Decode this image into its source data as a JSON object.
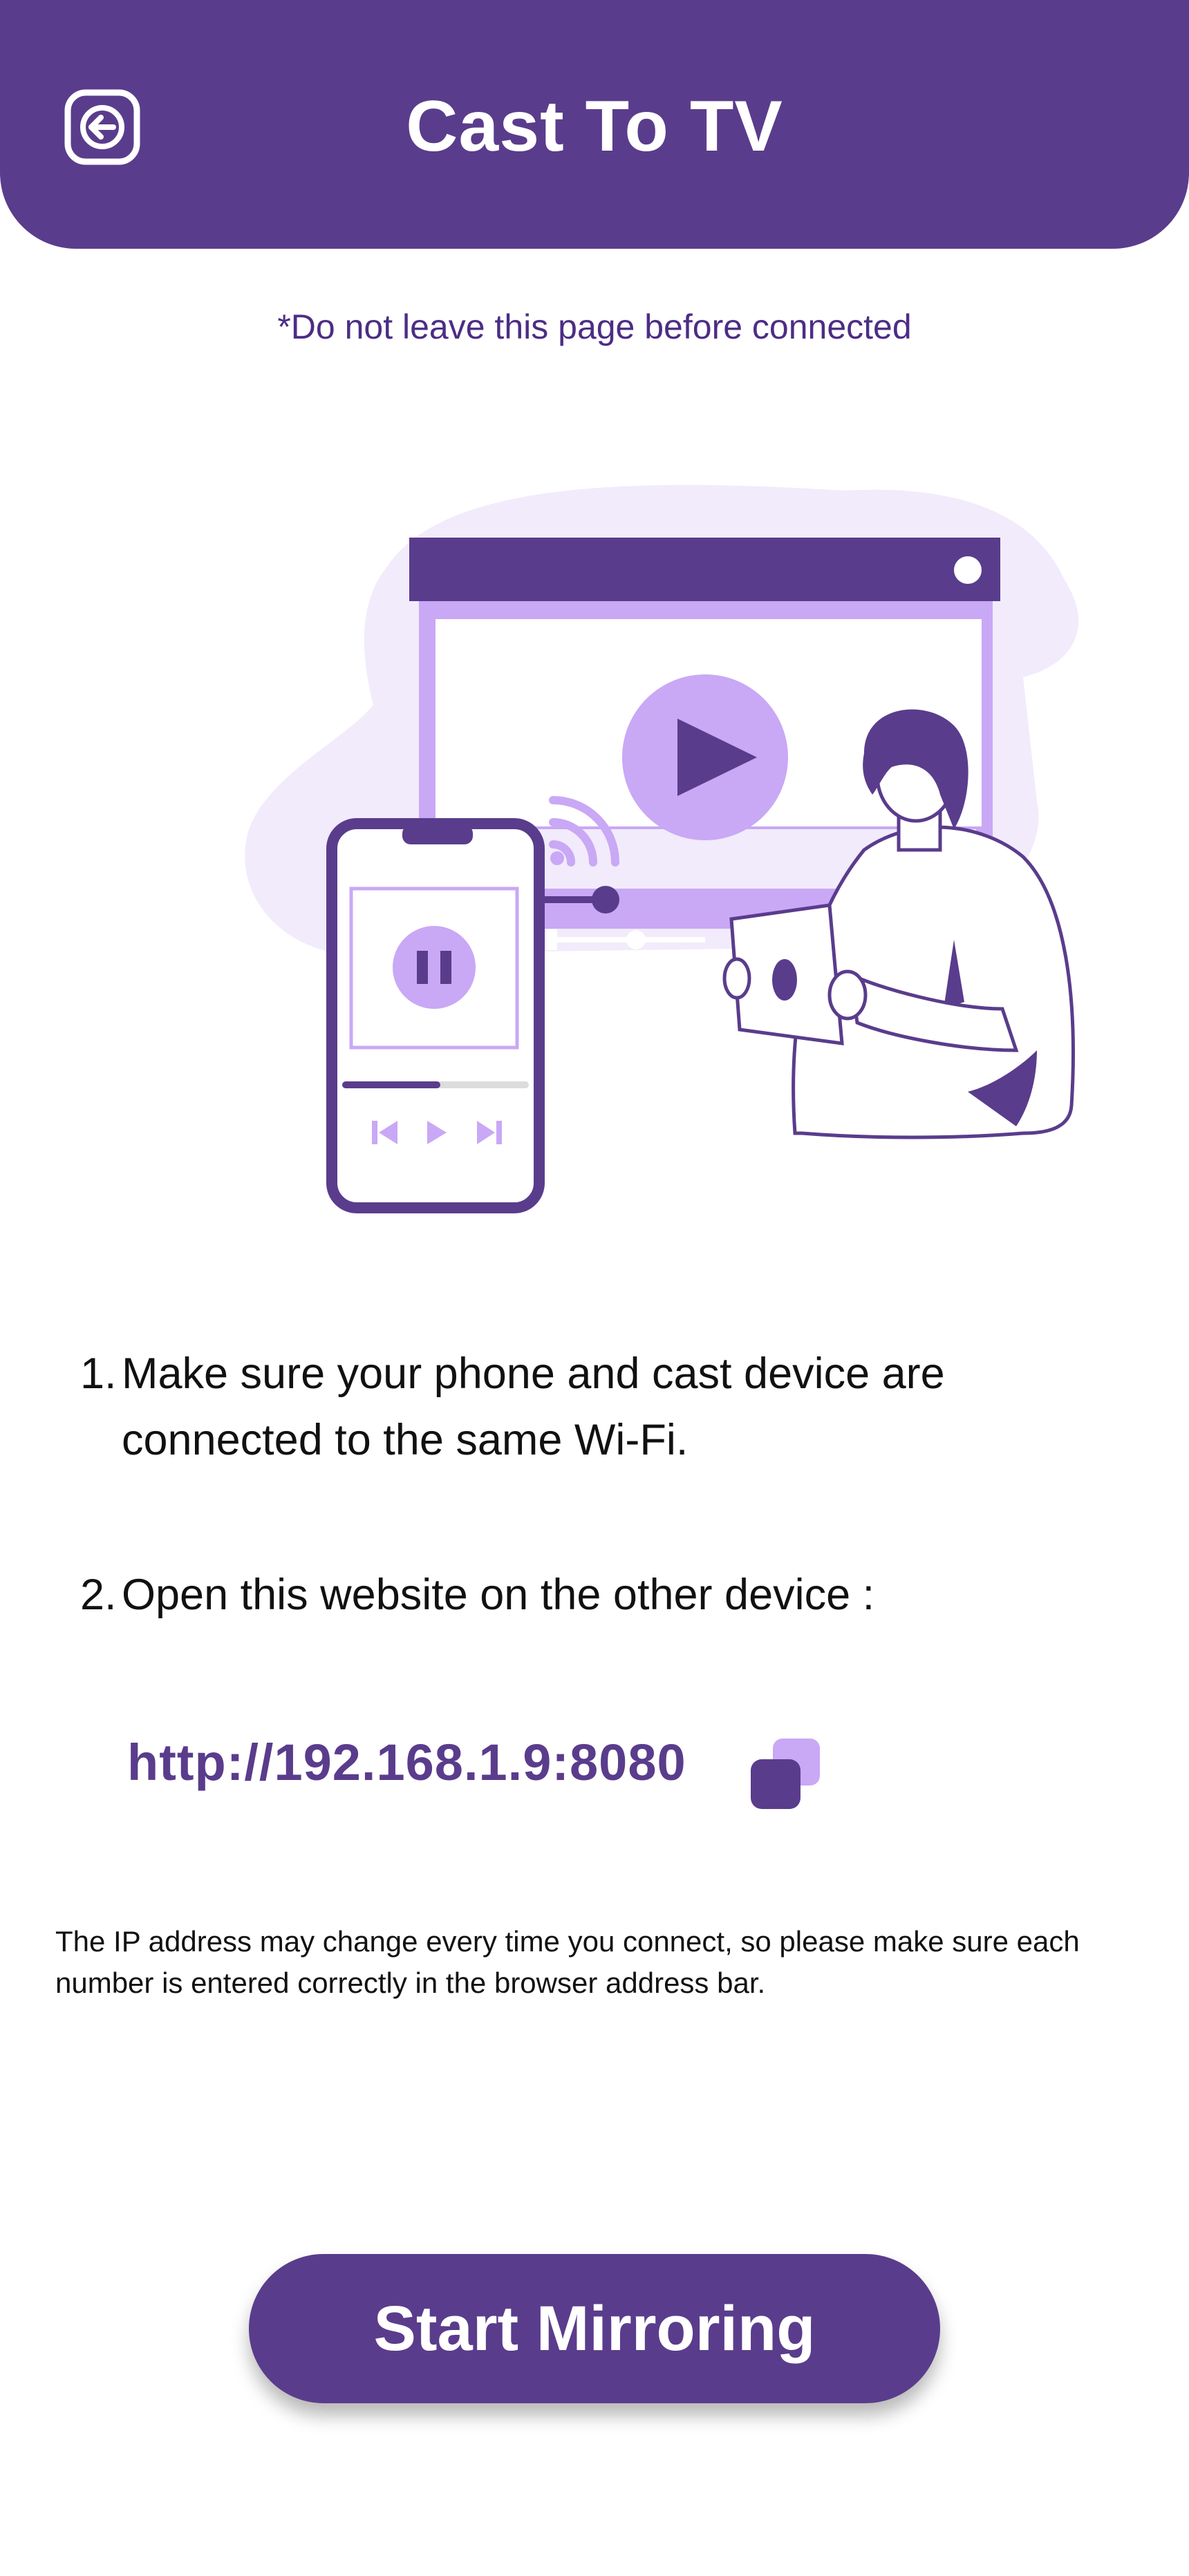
{
  "header": {
    "title": "Cast To TV",
    "back_icon": "back-arrow-icon"
  },
  "warning": "*Do not leave this page before connected",
  "illustration": {
    "description_icon": "cast-to-tv-illustration"
  },
  "steps": [
    {
      "number": "1.",
      "line1": "Make sure your phone and cast device are",
      "line2": "connected to the same Wi-Fi."
    },
    {
      "number": "2.",
      "line1": "Open this website on the other device :"
    }
  ],
  "url": "http://192.168.1.9:8080",
  "copy_icon": "copy-icon",
  "note": "The IP address may change every time you connect, so please make sure each number is entered correctly in the browser address bar.",
  "start_button": "Start Mirroring",
  "colors": {
    "primary": "#5a3c8c",
    "light": "#c9a8f5",
    "pale": "#f1ebfb"
  }
}
